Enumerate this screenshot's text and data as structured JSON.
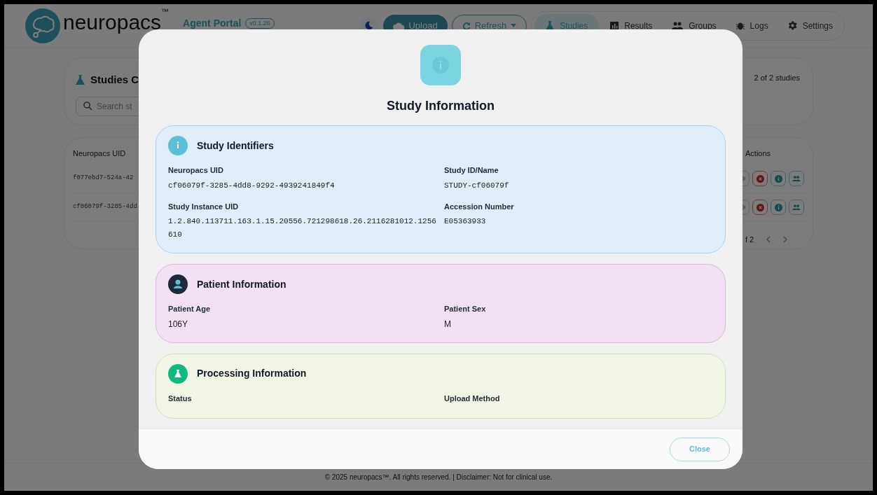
{
  "header": {
    "brand": "neuropacs",
    "trademark": "™",
    "app_title": "Agent Portal",
    "version": "v0.1.26",
    "upload_button": "Upload",
    "refresh_button": "Refresh",
    "nav": [
      {
        "label": "Studies",
        "selected": true
      },
      {
        "label": "Results",
        "selected": false
      },
      {
        "label": "Groups",
        "selected": false
      },
      {
        "label": "Logs",
        "selected": false
      },
      {
        "label": "Settings",
        "selected": false
      }
    ]
  },
  "studies_card": {
    "title": "Studies C",
    "search_placeholder": "Search st",
    "count": "2 of 2 studies"
  },
  "table": {
    "columns": [
      "Neuropacs UID",
      "Actions"
    ],
    "rows": [
      {
        "uid": "f077ebd7-524a-42"
      },
      {
        "uid": "cf06079f-3285-4dd"
      }
    ],
    "pagination": "f 2"
  },
  "footer": "© 2025 neuropacs™. All rights reserved. | Disclaimer: Not for clinical use.",
  "modal": {
    "title": "Study Information",
    "sections": [
      {
        "kind": "identifiers",
        "title": "Study Identifiers",
        "fields": [
          {
            "label": "Neuropacs UID",
            "value": "cf06079f-3285-4dd8-9292-4939241849f4"
          },
          {
            "label": "Study ID/Name",
            "value": "STUDY-cf06079f"
          },
          {
            "label": "Study Instance UID",
            "value": "1.2.840.113711.163.1.15.20556.721298618.26.2116281012.1256610"
          },
          {
            "label": "Accession Number",
            "value": "E05363933"
          }
        ]
      },
      {
        "kind": "patient",
        "title": "Patient Information",
        "fields": [
          {
            "label": "Patient Age",
            "value": "106Y"
          },
          {
            "label": "Patient Sex",
            "value": "M"
          }
        ]
      },
      {
        "kind": "processing",
        "title": "Processing Information",
        "fields": [
          {
            "label": "Status"
          },
          {
            "label": "Upload Method"
          }
        ]
      }
    ],
    "close_button": "Close"
  }
}
